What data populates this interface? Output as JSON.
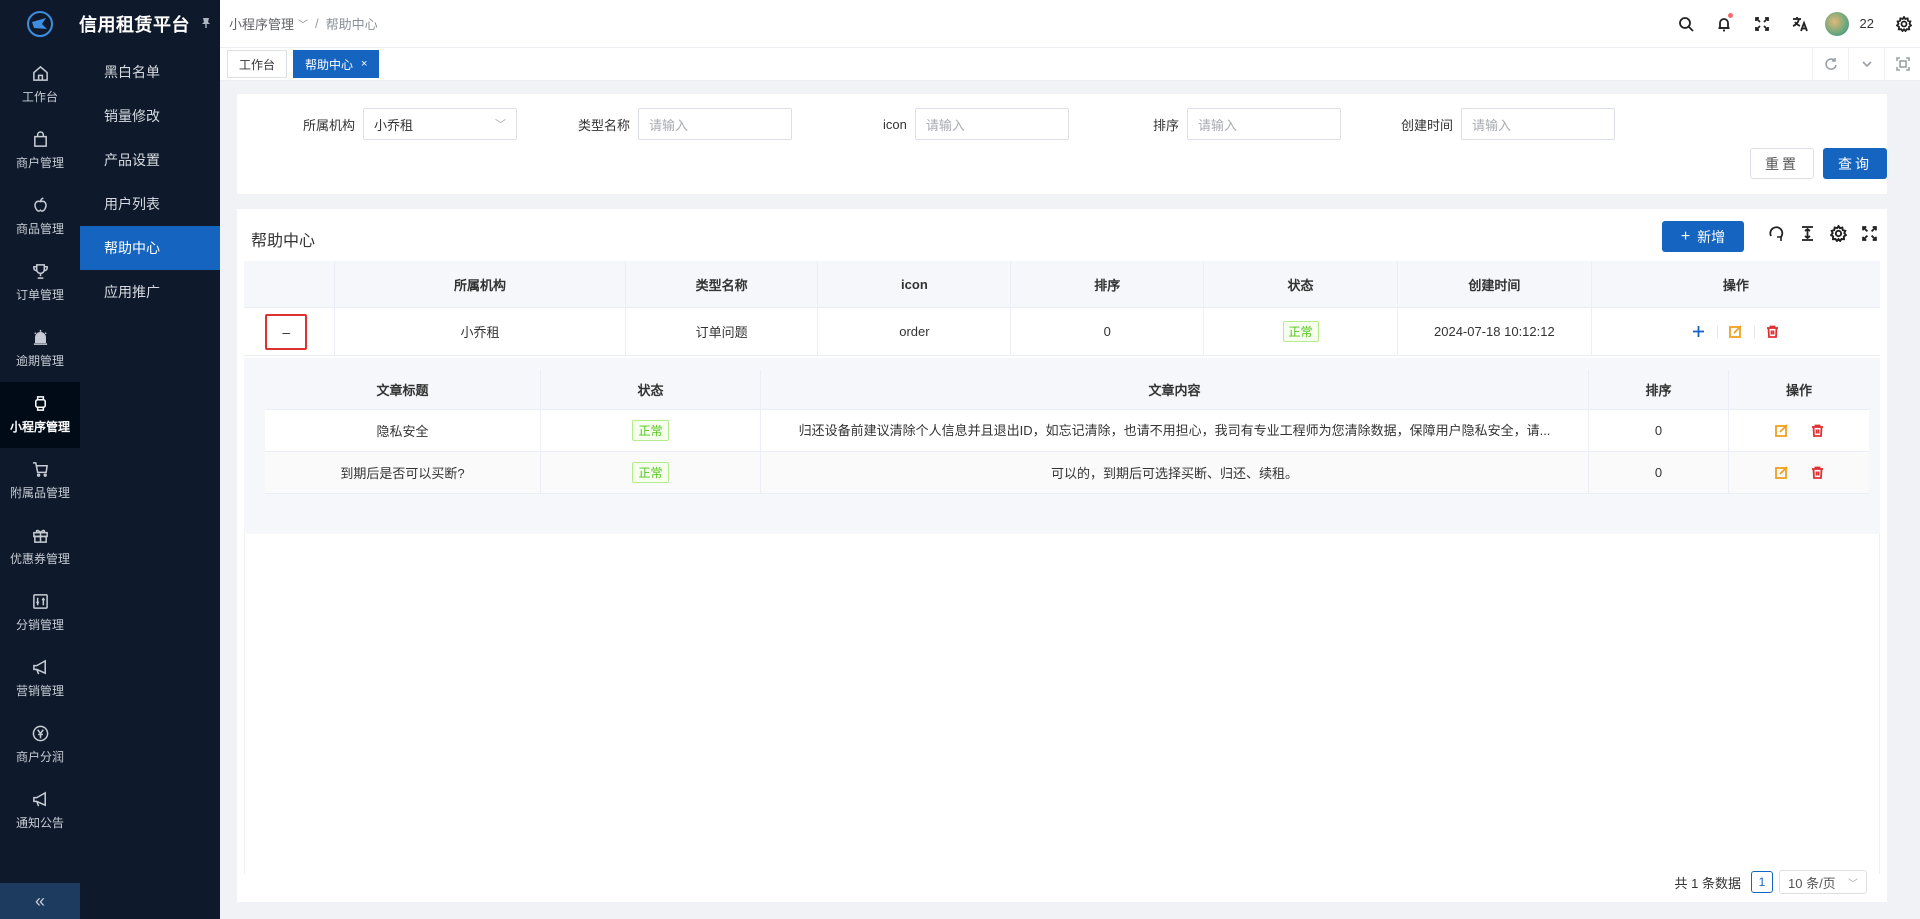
{
  "app": {
    "title": "信用租赁平台"
  },
  "iconbar": {
    "items": [
      {
        "label": "工作台",
        "icon": "home-icon"
      },
      {
        "label": "商户管理",
        "icon": "shop-icon"
      },
      {
        "label": "商品管理",
        "icon": "apple-icon"
      },
      {
        "label": "订单管理",
        "icon": "trophy-icon"
      },
      {
        "label": "逾期管理",
        "icon": "alarm-icon"
      },
      {
        "label": "小程序管理",
        "icon": "watch-icon",
        "active": true
      },
      {
        "label": "附属品管理",
        "icon": "cart-icon"
      },
      {
        "label": "优惠券管理",
        "icon": "gift-icon"
      },
      {
        "label": "分销管理",
        "icon": "sliders-icon"
      },
      {
        "label": "营销管理",
        "icon": "megaphone-icon"
      },
      {
        "label": "商户分润",
        "icon": "yen-icon"
      },
      {
        "label": "通知公告",
        "icon": "notice-icon"
      }
    ],
    "collapse": "«"
  },
  "submenu": {
    "items": [
      {
        "label": "黑白名单"
      },
      {
        "label": "销量修改"
      },
      {
        "label": "产品设置"
      },
      {
        "label": "用户列表"
      },
      {
        "label": "帮助中心",
        "active": true
      },
      {
        "label": "应用推广"
      }
    ]
  },
  "header": {
    "breadcrumb": {
      "parent": "小程序管理",
      "current": "帮助中心",
      "separator": "/"
    },
    "username": "22"
  },
  "tabs": [
    {
      "label": "工作台"
    },
    {
      "label": "帮助中心",
      "active": true,
      "close": "×"
    }
  ],
  "search": {
    "fields": [
      {
        "label": "所属机构",
        "value": "小乔租"
      },
      {
        "label": "类型名称",
        "placeholder": "请输入"
      },
      {
        "label": "icon",
        "placeholder": "请输入"
      },
      {
        "label": "排序",
        "placeholder": "请输入"
      },
      {
        "label": "创建时间",
        "placeholder": "请输入"
      }
    ],
    "reset_label": "重置",
    "query_label": "查询"
  },
  "table": {
    "title": "帮助中心",
    "add_label": "新增",
    "columns": [
      "",
      "所属机构",
      "类型名称",
      "icon",
      "排序",
      "状态",
      "创建时间",
      "操作"
    ],
    "rows": [
      {
        "expand": "–",
        "org": "小乔租",
        "type": "订单问题",
        "icon": "order",
        "sort": "0",
        "status": "正常",
        "created": "2024-07-18 10:12:12"
      }
    ],
    "sub_columns": [
      "文章标题",
      "状态",
      "文章内容",
      "排序",
      "操作"
    ],
    "sub_rows": [
      {
        "title": "隐私安全",
        "status": "正常",
        "content": "归还设备前建议清除个人信息并且退出ID，如忘记清除，也请不用担心，我司有专业工程师为您清除数据，保障用户隐私安全，请...",
        "sort": "0"
      },
      {
        "title": "到期后是否可以买断?",
        "status": "正常",
        "content": "可以的，到期后可选择买断、归还、续租。",
        "sort": "0"
      }
    ]
  },
  "pager": {
    "total_text": "共 1 条数据",
    "page": "1",
    "page_size": "10 条/页"
  },
  "colors": {
    "primary": "#1565c0",
    "sidebar": "#0e1a2b",
    "success": "#52c41a",
    "danger": "#e03131",
    "warning": "#f0a020"
  }
}
